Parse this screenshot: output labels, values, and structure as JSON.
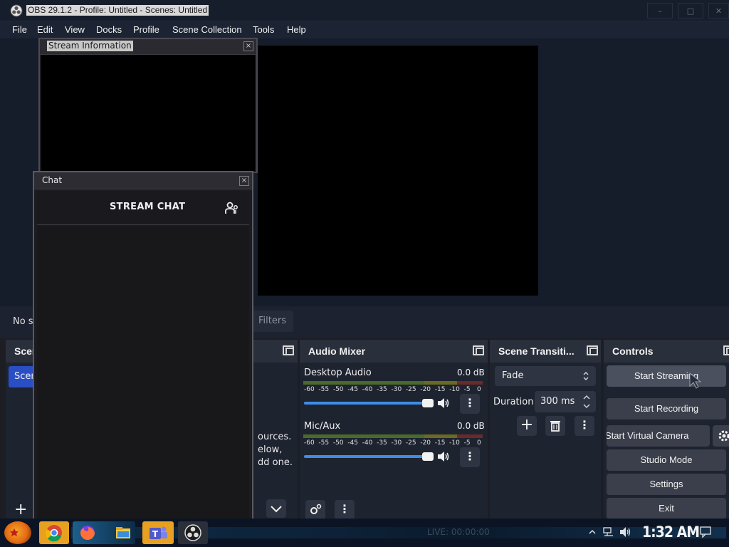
{
  "window": {
    "title": "OBS 29.1.2 - Profile: Untitled - Scenes: Untitled",
    "controls": [
      "–",
      "□",
      "✕"
    ]
  },
  "menu": [
    "File",
    "Edit",
    "View",
    "Docks",
    "Profile",
    "Scene Collection",
    "Tools",
    "Help"
  ],
  "status": {
    "no_source_text": "No s",
    "filters_label": "Filters"
  },
  "scenes": {
    "title": "Scer",
    "selected": "Scer",
    "add_label": "+"
  },
  "sources": {
    "empty_text_lines": [
      "ources.",
      "elow,",
      "dd one."
    ]
  },
  "audio_mixer": {
    "title": "Audio Mixer",
    "channels": [
      {
        "name": "Desktop Audio",
        "db": "0.0 dB",
        "volume": 1.0
      },
      {
        "name": "Mic/Aux",
        "db": "0.0 dB",
        "volume": 1.0
      }
    ],
    "ticks": [
      "-60",
      "-55",
      "-50",
      "-45",
      "-40",
      "-35",
      "-30",
      "-25",
      "-20",
      "-15",
      "-10",
      "-5",
      "0"
    ]
  },
  "scene_transitions": {
    "title": "Scene Transiti...",
    "transition": "Fade",
    "duration_label": "Duration",
    "duration_value": "300 ms"
  },
  "controls": {
    "title": "Controls",
    "start_streaming": "Start Streaming",
    "start_recording": "Start Recording",
    "start_virtual_camera": "Start Virtual Camera",
    "studio_mode": "Studio Mode",
    "settings": "Settings",
    "exit": "Exit"
  },
  "stream_information": {
    "title": "Stream Information"
  },
  "chat": {
    "title": "Chat",
    "header": "STREAM CHAT"
  },
  "taskbar": {
    "live_status": "LIVE: 00:00:00",
    "clock": "1:32 AM"
  },
  "colors": {
    "accent_blue": "#3d8ee8",
    "scene_selected": "#2a4fc4",
    "chrome_orange": "#f2a227",
    "obs_gray": "#3a3a3a"
  }
}
